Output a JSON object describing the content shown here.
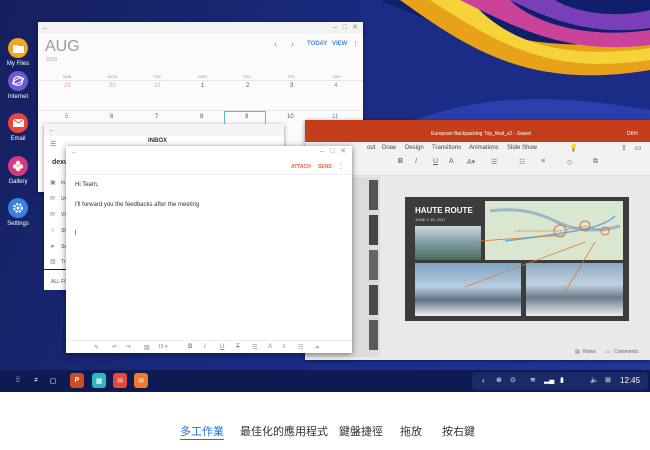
{
  "dock": {
    "apps": [
      {
        "label": "My Files",
        "icon": "folder-icon",
        "color": "#f1a522"
      },
      {
        "label": "Internet",
        "icon": "globe-icon",
        "color": "#6a5ad4"
      },
      {
        "label": "Email",
        "icon": "envelope-icon",
        "color": "#e8483c"
      },
      {
        "label": "Gallery",
        "icon": "flower-icon",
        "color": "#d6397d"
      },
      {
        "label": "Settings",
        "icon": "gear-icon",
        "color": "#3d7fe0"
      }
    ]
  },
  "calendar": {
    "month": "AUG",
    "year": "2018",
    "today_label": "TODAY",
    "view_label": "VIEW",
    "weekdays": [
      "SUN",
      "MON",
      "TUE",
      "WED",
      "THU",
      "FRI",
      "SAT"
    ],
    "week1": [
      "29",
      "30",
      "31",
      "1",
      "2",
      "3",
      "4"
    ],
    "week2": [
      "5",
      "6",
      "7",
      "8",
      "9",
      "10",
      "11"
    ]
  },
  "email_list": {
    "title": "INBOX",
    "account": "dexun",
    "folders": [
      "In",
      "Ur",
      "VI",
      "St",
      "Se",
      "Tr"
    ],
    "all_folders": "ALL FOL"
  },
  "compose": {
    "attach_label": "ATTACH",
    "send_label": "SEND",
    "greeting": "Hi Team,",
    "body": "I'll forward you the feedbacks after the meeting"
  },
  "powerpoint": {
    "title": "European Backpacking Trip_final_v2 - Saved",
    "user": "DKH",
    "menu": [
      "Draw",
      "Design",
      "Transitions",
      "Animations",
      "Slide Show"
    ],
    "menu_partial": "out",
    "slide_title": "HAUTE ROUTE",
    "slide_date": "JUNE 1-15, 2017",
    "notes_label": "Notes",
    "comments_label": "Comments",
    "colors": {
      "accent": "#c43e1c",
      "slide_bg": "#3b3b3b"
    }
  },
  "taskbar": {
    "time": "12:45",
    "pinned": [
      {
        "icon": "powerpoint-icon",
        "color": "#d04a24"
      },
      {
        "icon": "calendar-icon",
        "color": "#2fb8c4"
      },
      {
        "icon": "email-icon",
        "color": "#e8483c"
      },
      {
        "icon": "email-icon",
        "color": "#f07a2a"
      }
    ]
  },
  "tabs": [
    "多工作業",
    "最佳化的應用程式",
    "鍵盤捷徑",
    "拖放",
    "按右鍵"
  ]
}
